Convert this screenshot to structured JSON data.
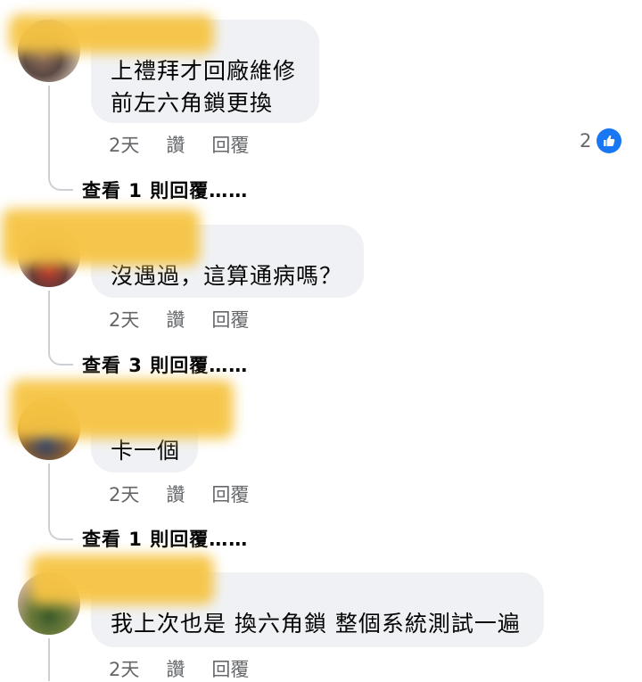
{
  "comments": [
    {
      "text": "上禮拜才回廠維修\n前左六角鎖更換",
      "time": "2天",
      "like_label": "讚",
      "reply_label": "回覆",
      "reaction_count": "2",
      "replies_link": "查看 1 則回覆……",
      "reaction_icon": "like-icon",
      "accent_color": "#1877f2"
    },
    {
      "text": "沒遇過，這算通病嗎？",
      "time": "2天",
      "like_label": "讚",
      "reply_label": "回覆",
      "replies_link": "查看 3 則回覆……"
    },
    {
      "text": "卡一個",
      "time": "2天",
      "like_label": "讚",
      "reply_label": "回覆",
      "replies_link": "查看 1 則回覆……"
    },
    {
      "text": "我上次也是 換六角鎖 整個系統測試一遍",
      "time": "2天",
      "like_label": "讚",
      "reply_label": "回覆"
    }
  ]
}
